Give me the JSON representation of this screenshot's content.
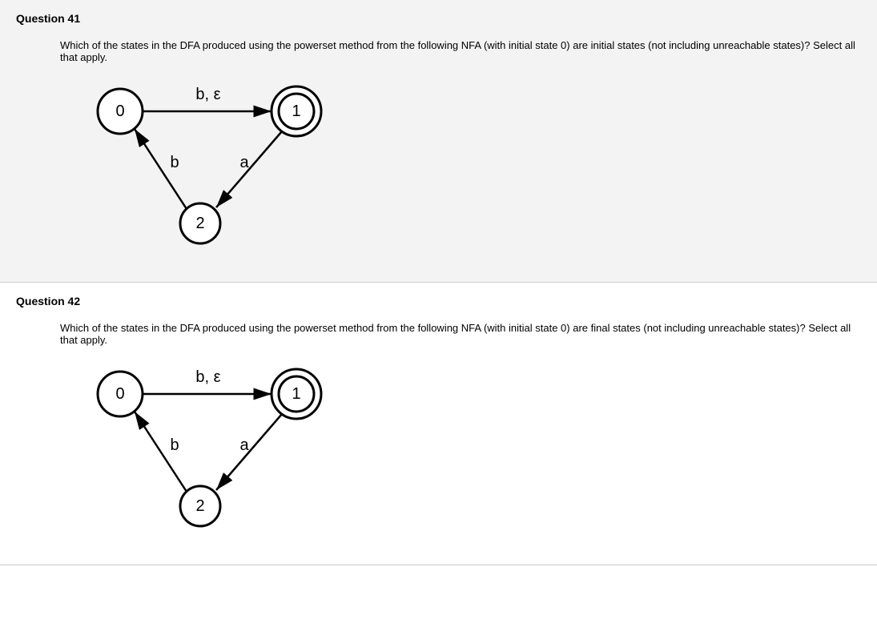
{
  "q41": {
    "title": "Question 41",
    "prompt": "Which of the states in the DFA produced using the powerset method from the following NFA (with initial state 0) are initial states (not including unreachable states)? Select all that apply.",
    "nfa": {
      "node0": "0",
      "node1": "1",
      "node2": "2",
      "edge01": "b, ε",
      "edge12": "a",
      "edge20": "b"
    }
  },
  "q42": {
    "title": "Question 42",
    "prompt": "Which of the states in the DFA produced using the powerset method from the following NFA (with initial state 0) are final states (not including unreachable states)? Select all that apply.",
    "nfa": {
      "node0": "0",
      "node1": "1",
      "node2": "2",
      "edge01": "b, ε",
      "edge12": "a",
      "edge20": "b"
    }
  }
}
